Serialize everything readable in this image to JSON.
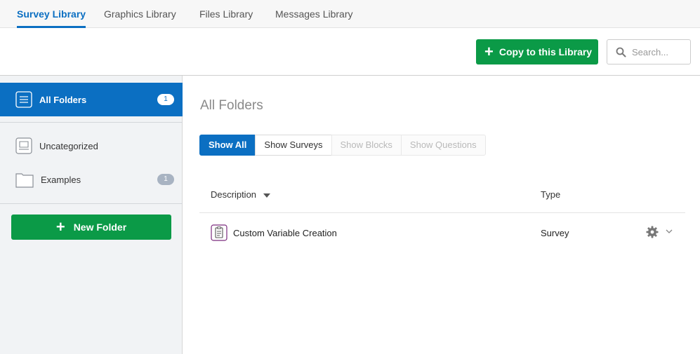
{
  "tabs": [
    {
      "label": "Survey Library",
      "active": true
    },
    {
      "label": "Graphics Library"
    },
    {
      "label": "Files Library"
    },
    {
      "label": "Messages Library"
    }
  ],
  "toolbar": {
    "copy_label": "Copy to this Library",
    "search_placeholder": "Search..."
  },
  "sidebar": {
    "all_folders": {
      "label": "All Folders",
      "count": "1"
    },
    "items": [
      {
        "label": "Uncategorized",
        "icon": "inbox-tray-icon"
      },
      {
        "label": "Examples",
        "icon": "folder-icon",
        "count": "1"
      }
    ],
    "new_folder_label": "New Folder"
  },
  "main": {
    "title": "All Folders",
    "filters": [
      "Show All",
      "Show Surveys",
      "Show Blocks",
      "Show Questions"
    ],
    "columns": {
      "description": "Description",
      "type": "Type"
    },
    "rows": [
      {
        "description": "Custom Variable Creation",
        "type": "Survey",
        "icon": "survey-clipboard-icon"
      }
    ]
  },
  "colors": {
    "primary_blue": "#0b6fc2",
    "success_green": "#0b9a47",
    "survey_icon_purple": "#7b2b7e"
  }
}
